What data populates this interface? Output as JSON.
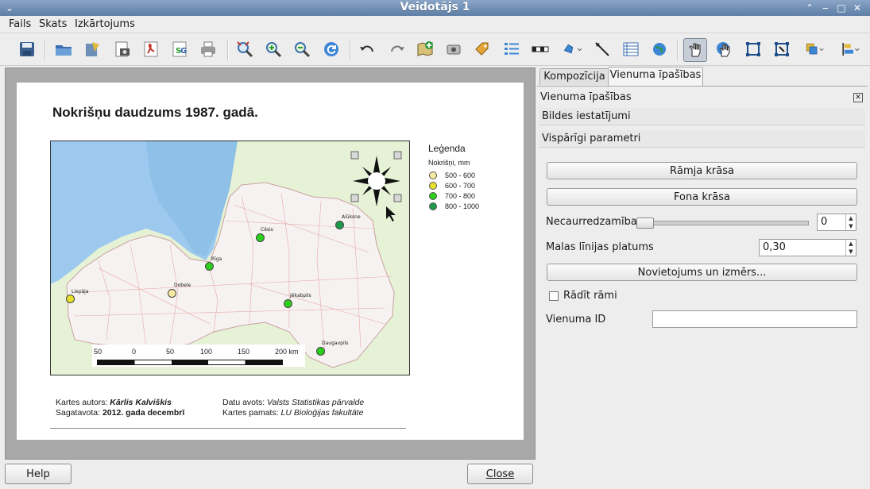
{
  "window": {
    "title": "Veidotājs 1"
  },
  "menu": {
    "items": [
      "Fails",
      "Skats",
      "Izkārtojums"
    ]
  },
  "map": {
    "title": "Nokrišņu daudzums 1987. gadā.",
    "legend_title": "Leģenda",
    "legend_subtitle": "Nokrišņi, mm",
    "legend_items": [
      {
        "label": "500 - 600",
        "color": "#f6eaa0"
      },
      {
        "label": "600 - 700",
        "color": "#e8e02a"
      },
      {
        "label": "700 - 800",
        "color": "#2ccf1c"
      },
      {
        "label": "800 - 1000",
        "color": "#1f9a4a"
      }
    ],
    "scalebar_labels": [
      "50",
      "0",
      "50",
      "100",
      "150",
      "200 km"
    ],
    "cities": [
      {
        "name": "Cēsis",
        "color": "#2ccf1c"
      },
      {
        "name": "Alūksne",
        "color": "#1f9a4a"
      },
      {
        "name": "Rīga",
        "color": "#2ccf1c"
      },
      {
        "name": "Liepāja",
        "color": "#e8e02a"
      },
      {
        "name": "Dobele",
        "color": "#f6eaa0"
      },
      {
        "name": "Jēkabpils",
        "color": "#2ccf1c"
      },
      {
        "name": "Daugavpils",
        "color": "#2ccf1c"
      }
    ],
    "credits": {
      "author_label": "Kartes autors:",
      "author": "Kārlis Kalviškis",
      "prepared_label": "Sagatavota:",
      "prepared": "2012. gada decembrī",
      "source_label": "Datu avots:",
      "source": "Valsts Statistikas pārvalde",
      "base_label": "Kartes pamats:",
      "base": "LU Bioloģijas fakultāte"
    }
  },
  "panel": {
    "tabs": [
      "Kompozīcija",
      "Vienuma īpašības"
    ],
    "active_tab": "Vienuma īpašības",
    "header": "Vienuma īpašības",
    "sections": [
      "Bildes iestatījumi",
      "Vispārīgi parametri"
    ],
    "frame_color_button": "Rāmja krāsa",
    "background_color_button": "Fona krāsa",
    "opacity_label": "Necaurredzamība",
    "opacity_value": "0",
    "opacity_level": 0,
    "outline_label": "Malas līnijas platums",
    "outline_value": "0,30",
    "position_button": "Novietojums un izmērs...",
    "show_frame_label": "Rādīt rāmi",
    "show_frame_checked": false,
    "item_id_label": "Vienuma ID",
    "item_id_value": ""
  },
  "footer": {
    "help": "Help",
    "close": "Close"
  }
}
